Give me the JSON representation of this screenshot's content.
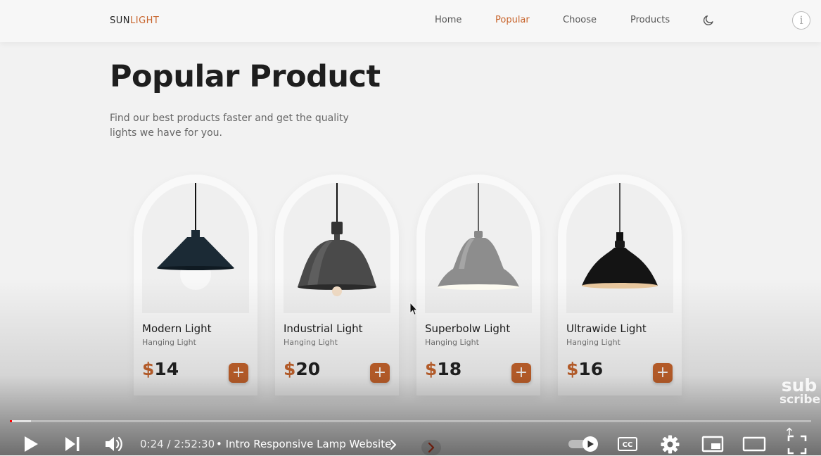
{
  "brand": {
    "prefix": "SUN",
    "accent": "LIGHT"
  },
  "nav": {
    "home": "Home",
    "popular": "Popular",
    "choose": "Choose",
    "products": "Products"
  },
  "info_glyph": "i",
  "section": {
    "title": "Popular Product",
    "description": "Find our best products faster and get the quality lights we have for you."
  },
  "products": [
    {
      "name": "Modern Light",
      "category": "Hanging Light",
      "currency": "$",
      "price": "14"
    },
    {
      "name": "Industrial Light",
      "category": "Hanging Light",
      "currency": "$",
      "price": "20"
    },
    {
      "name": "Superbolw Light",
      "category": "Hanging Light",
      "currency": "$",
      "price": "18"
    },
    {
      "name": "Ultrawide Light",
      "category": "Hanging Light",
      "currency": "$",
      "price": "16"
    }
  ],
  "add_glyph": "+",
  "watermark": {
    "line1": "sub",
    "line2": "scribe"
  },
  "player": {
    "current_time": "0:24",
    "separator": " / ",
    "duration": "2:52:30",
    "chapter_bullet": "•",
    "chapter_title": "Intro Responsive Lamp Website",
    "cc_label": "CC",
    "progress_played": 0.0023,
    "progress_loaded": 0.026
  },
  "colors": {
    "accent": "#c8652d",
    "progress_red": "#ff0000"
  },
  "icons": [
    "moon-icon",
    "info-icon",
    "lamp-icon",
    "plus-icon",
    "mouse-cursor-icon",
    "play-icon",
    "next-icon",
    "volume-icon",
    "chevron-right-icon",
    "autoplay-toggle-icon",
    "captions-icon",
    "settings-gear-icon",
    "miniplayer-icon",
    "theater-mode-icon",
    "fullscreen-icon"
  ]
}
